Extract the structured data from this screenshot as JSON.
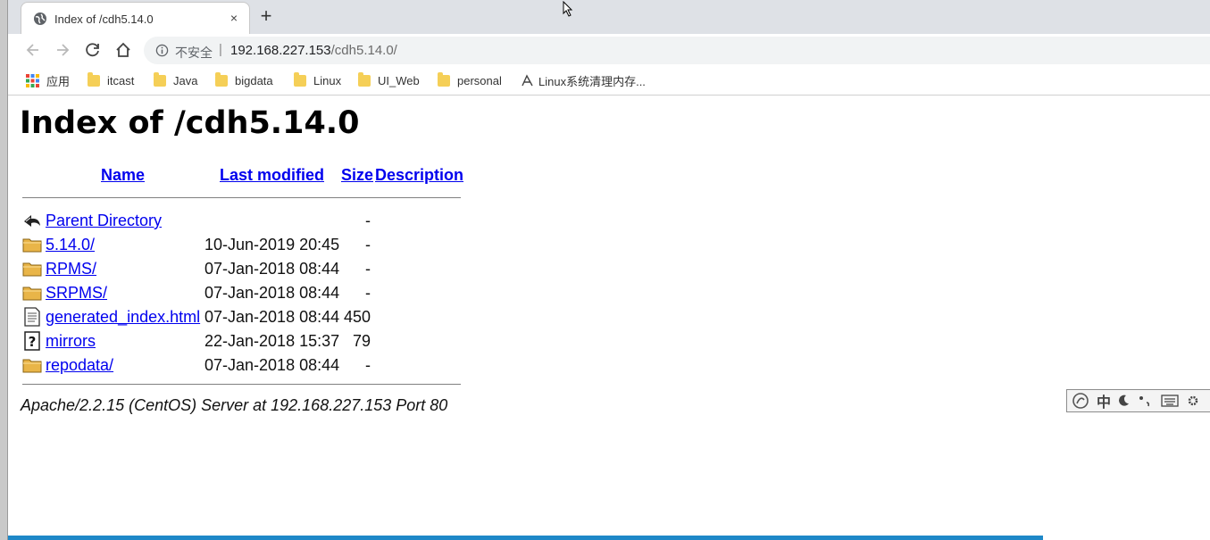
{
  "tab": {
    "title": "Index of /cdh5.14.0",
    "close": "×",
    "new_tab": "+"
  },
  "address_bar": {
    "security_label": "不安全",
    "separator": "|",
    "host": "192.168.227.153",
    "path": "/cdh5.14.0/"
  },
  "bookmarks": [
    {
      "label": "应用",
      "icon": "apps-grid-icon"
    },
    {
      "label": "itcast",
      "icon": "folder-icon"
    },
    {
      "label": "Java",
      "icon": "folder-icon"
    },
    {
      "label": "bigdata",
      "icon": "folder-icon"
    },
    {
      "label": "Linux",
      "icon": "folder-icon"
    },
    {
      "label": "UI_Web",
      "icon": "folder-icon"
    },
    {
      "label": "personal",
      "icon": "folder-icon"
    },
    {
      "label": "Linux系统清理内存...",
      "icon": "page-icon"
    }
  ],
  "page": {
    "title": "Index of /cdh5.14.0",
    "columns": {
      "name": "Name",
      "last_modified": "Last modified",
      "size": "Size",
      "description": "Description"
    },
    "rows": [
      {
        "name": "Parent Directory",
        "date": "",
        "size": "-",
        "icon": "back-arrow-icon"
      },
      {
        "name": "5.14.0/",
        "date": "10-Jun-2019 20:45",
        "size": "-",
        "icon": "folder-icon"
      },
      {
        "name": "RPMS/",
        "date": "07-Jan-2018 08:44",
        "size": "-",
        "icon": "folder-icon"
      },
      {
        "name": "SRPMS/",
        "date": "07-Jan-2018 08:44",
        "size": "-",
        "icon": "folder-icon"
      },
      {
        "name": "generated_index.html",
        "date": "07-Jan-2018 08:44",
        "size": "450",
        "icon": "document-icon"
      },
      {
        "name": "mirrors",
        "date": "22-Jan-2018 15:37",
        "size": "79",
        "icon": "unknown-file-icon"
      },
      {
        "name": "repodata/",
        "date": "07-Jan-2018 08:44",
        "size": "-",
        "icon": "folder-icon"
      }
    ],
    "footer": "Apache/2.2.15 (CentOS) Server at 192.168.227.153 Port 80"
  },
  "ime_toolbar": {
    "mode": "中",
    "items": [
      "moon-icon",
      "punctuation-icon",
      "keyboard-icon",
      "settings-icon"
    ]
  },
  "colors": {
    "link": "#0000ee",
    "folder": "#f5cf57",
    "tab_strip": "#dee1e6",
    "progress": "#1e88c8"
  }
}
